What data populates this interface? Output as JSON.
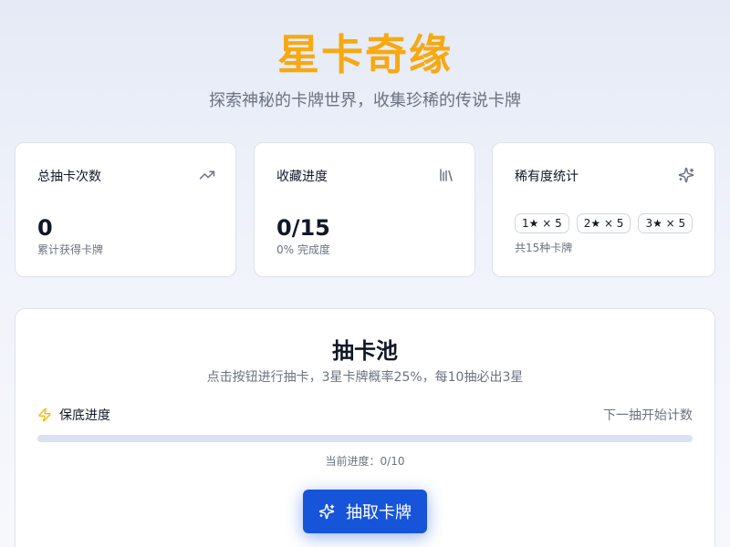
{
  "header": {
    "title": "星卡奇缘",
    "subtitle": "探索神秘的卡牌世界，收集珍稀的传说卡牌"
  },
  "stats": {
    "total_draws": {
      "label": "总抽卡次数",
      "value": "0",
      "caption": "累计获得卡牌",
      "icon": "trending-up-icon"
    },
    "collection": {
      "label": "收藏进度",
      "value": "0/15",
      "caption": "0% 完成度",
      "icon": "library-icon"
    },
    "rarity": {
      "label": "稀有度统计",
      "badges": [
        "1★ × 5",
        "2★ × 5",
        "3★ × 5"
      ],
      "caption": "共15种卡牌",
      "icon": "sparkles-icon"
    }
  },
  "pool": {
    "title": "抽卡池",
    "description": "点击按钮进行抽卡，3星卡牌概率25%，每10抽必出3星",
    "pity_label": "保底进度",
    "pity_status": "下一抽开始计数",
    "progress_text": "当前进度：0/10",
    "progress_fraction": 0,
    "draw_button": "抽取卡牌"
  },
  "colors": {
    "title_accent": "#f7a912",
    "primary": "#1654d9",
    "progress_track": "#d9e1f3",
    "pity_icon": "#f5b800"
  }
}
